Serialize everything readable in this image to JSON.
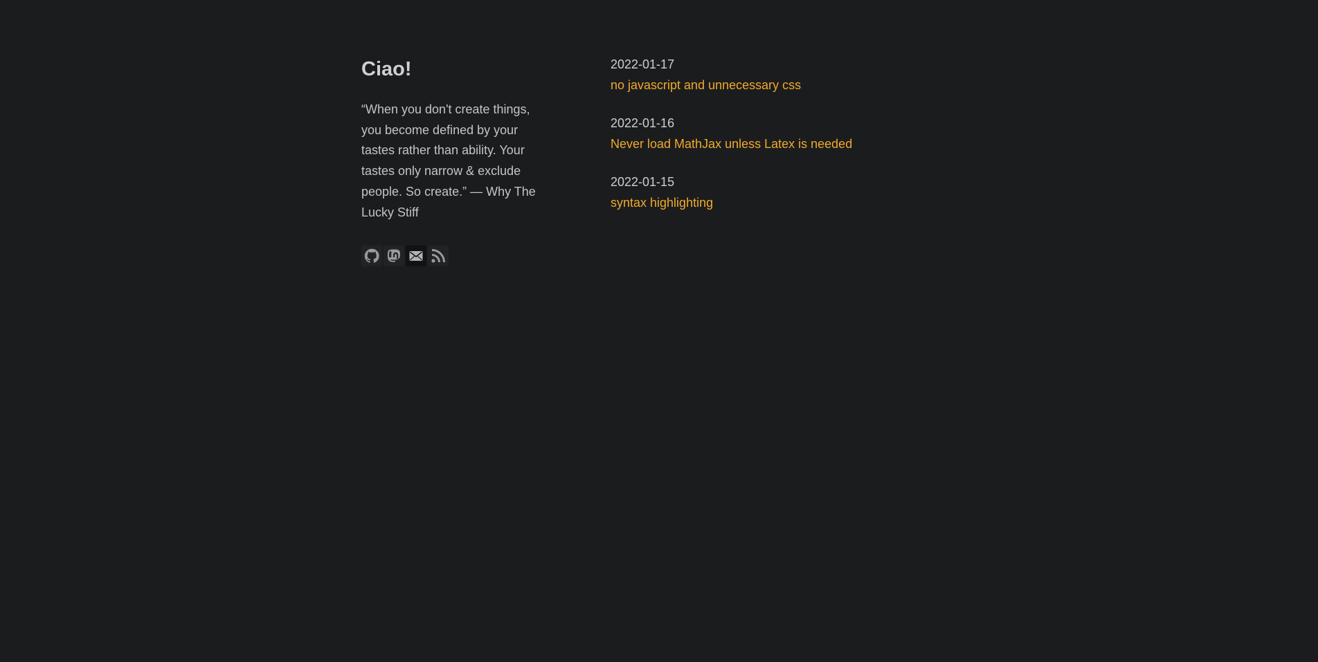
{
  "profile": {
    "greeting": "Ciao!",
    "quote": "“When you don't create things, you become defined by your tastes rather than ability. Your tastes only narrow & exclude people. So create.” — Why The Lucky Stiff"
  },
  "social_links": [
    {
      "icon": "github-icon"
    },
    {
      "icon": "mastodon-icon"
    },
    {
      "icon": "email-icon"
    },
    {
      "icon": "rss-icon"
    }
  ],
  "posts": [
    {
      "date": "2022-01-17",
      "title": "no javascript and unnecessary css"
    },
    {
      "date": "2022-01-16",
      "title": "Never load MathJax unless Latex is needed"
    },
    {
      "date": "2022-01-15",
      "title": "syntax highlighting"
    }
  ],
  "colors": {
    "background": "#1b1c1e",
    "text": "#c9c9c9",
    "link": "#f0aa2a",
    "icon": "#9a9a9a"
  }
}
